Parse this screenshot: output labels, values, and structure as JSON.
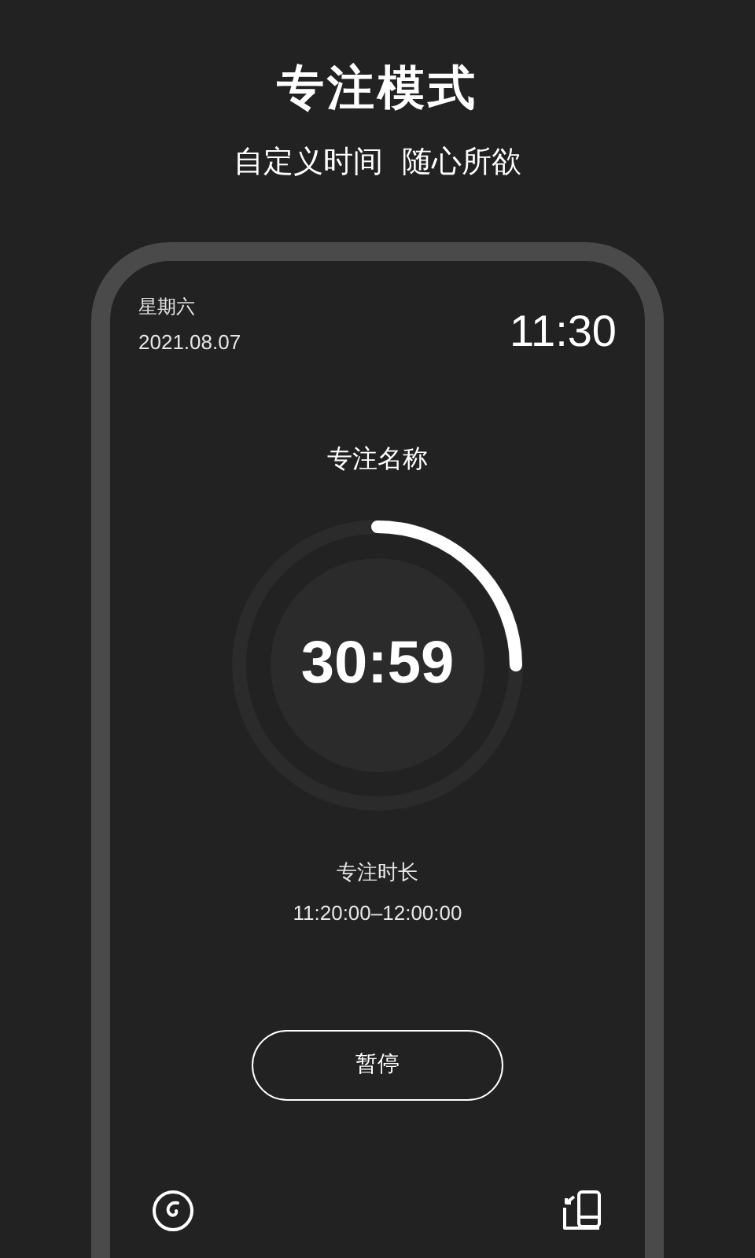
{
  "headline": {
    "title": "专注模式",
    "subtitle": "自定义时间  随心所欲"
  },
  "phone": {
    "weekday": "星期六",
    "date": "2021.08.07",
    "clock": "11:30",
    "focus_name": "专注名称",
    "timer": {
      "remaining": "30:59",
      "level": 0.25
    },
    "duration_label": "专注时长",
    "duration_range": "11:20:00–12:00:00",
    "pause_button": "暂停"
  }
}
